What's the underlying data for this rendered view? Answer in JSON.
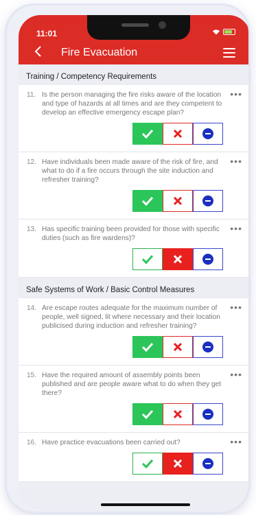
{
  "status": {
    "time": "11:01"
  },
  "header": {
    "title": "Fire Evacuation"
  },
  "sections": [
    {
      "title": "Training / Competency Requirements",
      "questions": [
        {
          "num": "11.",
          "text": "Is the person managing the fire risks aware of the location and type of hazards at all times and are they competent to develop an effective emergency escape plan?",
          "answer": "yes"
        },
        {
          "num": "12.",
          "text": "Have individuals been made aware of the risk of fire, and what to do if a fire occurs through the site induction and refresher training?",
          "answer": "yes"
        },
        {
          "num": "13.",
          "text": "Has specific training been provided for those with specific duties (such as fire wardens)?",
          "answer": "no"
        }
      ]
    },
    {
      "title": "Safe Systems of Work / Basic Control Measures",
      "questions": [
        {
          "num": "14.",
          "text": "Are escape routes adequate for the maximum number of people, well signed, lit where necessary and their location publicised during induction and refresher training?",
          "answer": "yes"
        },
        {
          "num": "15.",
          "text": "Have the required amount of assembly points been published and are people aware what to do when they get there?",
          "answer": "yes"
        },
        {
          "num": "16.",
          "text": "Have practice evacuations been carried out?",
          "answer": "no"
        }
      ]
    }
  ],
  "more_label": "•••",
  "colors": {
    "header": "#dc2c26",
    "yes": "#2cc559",
    "no": "#e8211f",
    "na": "#1a2fc0"
  }
}
